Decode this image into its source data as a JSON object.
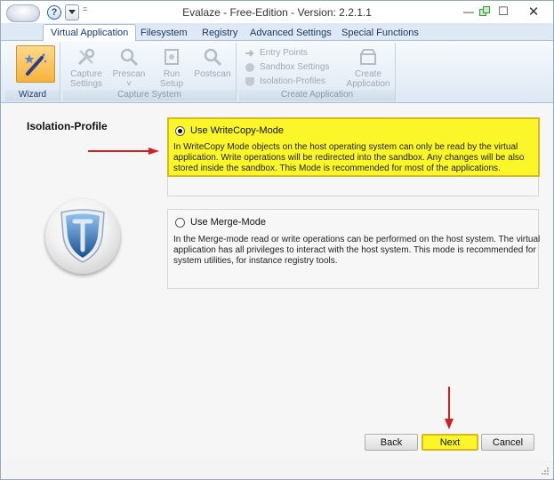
{
  "window": {
    "title": "Evalaze - Free-Edition - Version: 2.2.1.1",
    "help_glyph": "?",
    "qat_more": "=",
    "controls": {
      "minimize": "—",
      "maximize": "☐",
      "close": "✕"
    }
  },
  "tabs": [
    {
      "label": "Virtual Application",
      "active": true
    },
    {
      "label": "Filesystem",
      "active": false
    },
    {
      "label": "Registry",
      "active": false
    },
    {
      "label": "Advanced Settings",
      "active": false
    },
    {
      "label": "Special Functions",
      "active": false
    }
  ],
  "ribbon": {
    "wizard_group": {
      "label": "Wizard",
      "icon": "magic-wand-icon"
    },
    "capture_group": {
      "label": "Capture System",
      "buttons": [
        {
          "label1": "Capture",
          "label2": "Settings",
          "icon": "tools-icon"
        },
        {
          "label1": "Prescan",
          "label2": "˅",
          "icon": "magnifier-icon"
        },
        {
          "label1": "Run",
          "label2": "Setup",
          "icon": "setup-icon"
        },
        {
          "label1": "Postscan",
          "label2": "",
          "icon": "magnifier-icon"
        }
      ]
    },
    "create_group": {
      "label": "Create Application",
      "items": [
        {
          "label": "Entry Points",
          "icon": "arrow-icon"
        },
        {
          "label": "Sandbox Settings",
          "icon": "sphere-icon"
        },
        {
          "label": "Isolation-Profiles",
          "icon": "shield-icon"
        }
      ],
      "create_button": {
        "label1": "Create",
        "label2": "Application",
        "icon": "package-icon"
      }
    }
  },
  "content": {
    "section_title": "Isolation-Profile",
    "options": [
      {
        "label": "Use WriteCopy-Mode",
        "selected": true,
        "description_lines": [
          "In WriteCopy Mode objects on the host operating system can only be read by the virtual",
          "application. Write operations will be redirected into the sandbox. Any changes will be also",
          "stored inside the sandbox. This Mode is recommended for most of the applications."
        ]
      },
      {
        "label": "Use Merge-Mode",
        "selected": false,
        "description_lines": [
          "In the Merge-mode read or write operations can be performed on the host system. The virtual",
          "application has all privileges to interact with the host system. This mode is recommended for",
          "system utilities, for instance registry tools."
        ]
      }
    ]
  },
  "buttons": {
    "back": "Back",
    "next": "Next",
    "cancel": "Cancel"
  },
  "colors": {
    "highlight": "#fbf62a",
    "arrow": "#d21f1f",
    "accent": "#2a5ca8"
  }
}
